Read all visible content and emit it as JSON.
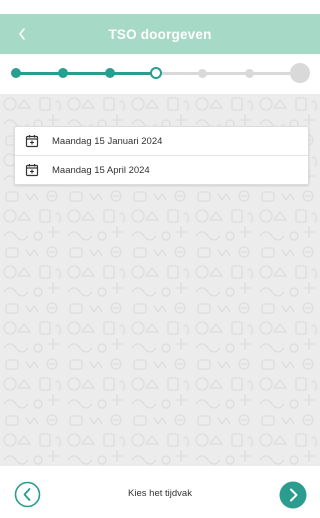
{
  "header": {
    "title": "TSO doorgeven",
    "back_icon": "chevron-left-icon"
  },
  "stepper": {
    "total_steps": 7,
    "current_step": 4,
    "accent_color": "#2a9d8f",
    "inactive_color": "#d9d9d9"
  },
  "dates": [
    {
      "label": "Maandag 15 Januari 2024",
      "icon": "calendar-add-icon"
    },
    {
      "label": "Maandag 15 April 2024",
      "icon": "calendar-add-icon"
    }
  ],
  "footer": {
    "label": "Kies het tijdvak",
    "prev_icon": "chevron-left-circle-icon",
    "next_icon": "chevron-right-circle-icon"
  },
  "colors": {
    "header_bg": "#a7dac6",
    "accent": "#2a9d8f",
    "content_bg": "#ececec"
  }
}
